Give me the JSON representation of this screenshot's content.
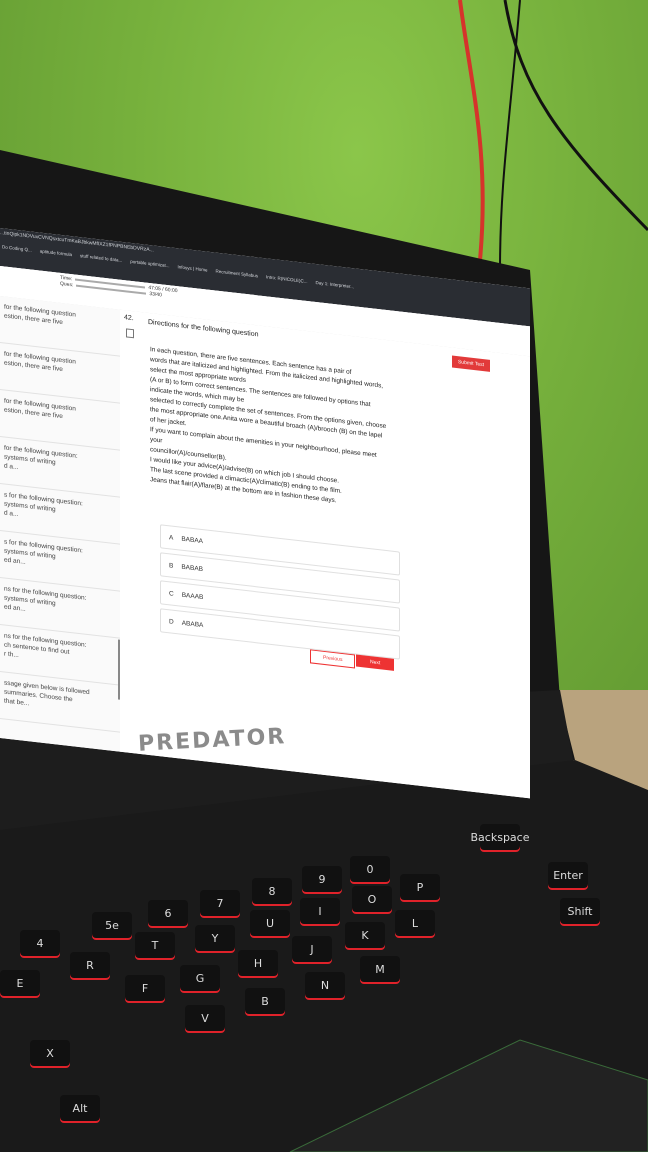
{
  "browser": {
    "tab_text": "...tinQipk1NDVuxCVNQsxtcuTmKaBJbkwMfIXZ1fPNPBNEbDVRzA...",
    "bookmarks": [
      "Do Coding Q...",
      "aptitude formula",
      "stuff related to data...",
      "portable optimizat...",
      "Infosys | Home",
      "Recruitment Syllabus",
      "Intro: R(NICOLE)C...",
      "Day 1: Interpreter..."
    ]
  },
  "timer": {
    "time_label": "Time:",
    "question_label": "Ques:",
    "time_value": "47:05 / 60:00",
    "question_value": "33/40"
  },
  "sidebar": {
    "items": [
      {
        "text": "for the following question\nestion, there are five"
      },
      {
        "text": "for the following question\nestion, there are five"
      },
      {
        "text": "for the following question\nestion, there are five"
      },
      {
        "text": "for the following question:\nsystems of writing\nd a..."
      },
      {
        "text": "s for the following question:\nsystems of writing\nd a..."
      },
      {
        "text": "s for the following question:\nsystems of writing\ned an..."
      },
      {
        "text": "ns for the following question:\nsystems of writing\ned an..."
      },
      {
        "text": "ns for the following question:\nch sentence to find out\nr th..."
      },
      {
        "text": "ssage given below is followed\nsummaries. Choose the\nthat be..."
      }
    ]
  },
  "question": {
    "number": "42.",
    "title": "Directions for the following question",
    "submit_label": "Submit Test",
    "body": [
      "In each question, there are five sentences. Each sentence has a pair of",
      "words that are italicized and highlighted. From the italicized and highlighted words,",
      "select the most appropriate words",
      "(A or B) to form correct sentences. The sentences are followed by options that",
      "indicate the words, which may be",
      "selected to correctly complete the set of sentences. From the options given, choose",
      "the most appropriate one.Anita wore a beautiful broach (A)/brooch (B) on the lapel",
      "of her jacket.",
      "If you want to complain about the amenities in your neighbourhood, please meet",
      "your",
      "councillor(A)/counsellor(B).",
      "I would like your advice(A)/advise(B) on which job I should choose.",
      "The last scene provided a climactic(A)/climatic(B) ending to the film.",
      "Jeans that flair(A)/flare(B) at the bottom are in fashion these days."
    ],
    "options": [
      {
        "letter": "A",
        "text": "BABAA"
      },
      {
        "letter": "B",
        "text": "BABAB"
      },
      {
        "letter": "C",
        "text": "BAAAB"
      },
      {
        "letter": "D",
        "text": "ABABA"
      }
    ],
    "previous_label": "Previous",
    "next_label": "Next"
  },
  "laptop": {
    "brand": "PREDATOR"
  },
  "keyboard": {
    "keys": [
      "4",
      "R",
      "E",
      "T",
      "5e",
      "6",
      "7",
      "8",
      "9",
      "0",
      "Y",
      "U",
      "I",
      "O",
      "P",
      "G",
      "H",
      "J",
      "K",
      "L",
      "V",
      "B",
      "N",
      "M",
      "F",
      "X",
      "Alt",
      "Enter",
      "Shift",
      "Backspace"
    ]
  },
  "colors": {
    "accent": "#e23a3a",
    "keyboard_glow": "#e0222a",
    "wall": "#7ab53f"
  }
}
